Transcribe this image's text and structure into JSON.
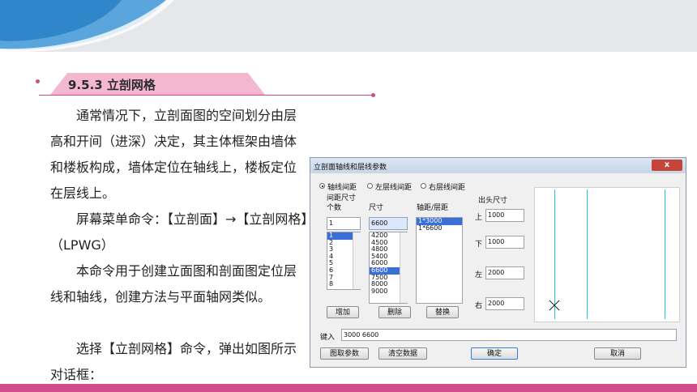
{
  "slide": {
    "section_title": "9.5.3 立剖网格",
    "paragraphs": [
      "　　通常情况下，立剖面图的空间划分由层高和开间（进深）决定，其主体框架由墙体和楼板构成，墙体定位在轴线上，楼板定位在层线上。",
      "　　屏幕菜单命令：【立剖面】→【立剖网格】（LPWG）",
      "　　本命令用于创建立面图和剖面图定位层线和轴线，创建方法与平面轴网类似。",
      "　　选择【立剖网格】命令，弹出如图所示对话框："
    ],
    "colors": {
      "accent": "#d04c8a",
      "tab": "#f3b8cf",
      "banner": "#e6e7ea",
      "wave": "#2f86c8"
    }
  },
  "dialog": {
    "title": "立剖面轴线和层线参数",
    "close_label": "x",
    "radio_options": [
      {
        "label": "轴线间距",
        "checked": true
      },
      {
        "label": "左层线间距",
        "checked": false
      },
      {
        "label": "右层线间距",
        "checked": false
      }
    ],
    "group_label": "间距尺寸",
    "count_label": "个数",
    "size_label": "尺寸",
    "axis_label": "轴距/层距",
    "count_value": "1",
    "size_value": "6600",
    "count_list": [
      "1",
      "2",
      "3",
      "4",
      "5",
      "6",
      "7",
      "8"
    ],
    "size_list": [
      "4200",
      "4500",
      "4800",
      "5400",
      "6000",
      "6600",
      "7500",
      "8000",
      "9000"
    ],
    "axis_list": [
      "1*3000",
      "1*6600"
    ],
    "overhang_label": "出头尺寸",
    "overhang": [
      {
        "label": "上",
        "value": "1000"
      },
      {
        "label": "下",
        "value": "1000"
      },
      {
        "label": "左",
        "value": "2000"
      },
      {
        "label": "右",
        "value": "2000"
      }
    ],
    "add_button": "增加",
    "delete_button": "删除",
    "replace_button": "替换",
    "key_in_label": "键入",
    "key_in_value": "3000  6600",
    "pick_button": "图取参数",
    "clear_button": "清空数据",
    "ok_button": "确定",
    "cancel_button": "取消"
  }
}
